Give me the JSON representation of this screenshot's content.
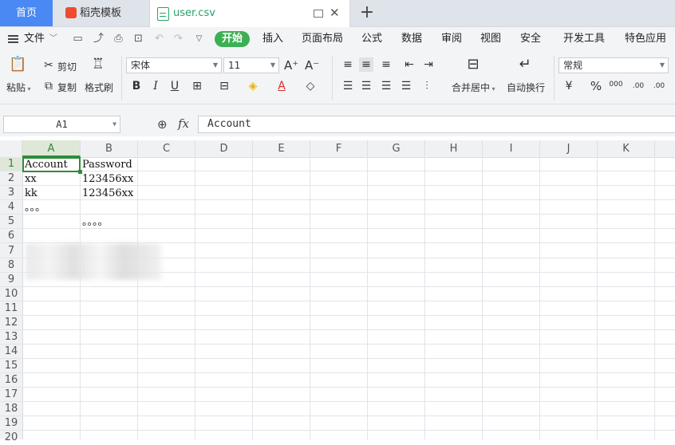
{
  "tabs": {
    "home": "首页",
    "template": "稻壳模板",
    "file": "user.csv"
  },
  "menu": {
    "file": "文件",
    "items": [
      "开始",
      "插入",
      "页面布局",
      "公式",
      "数据",
      "审阅",
      "视图",
      "安全",
      "开发工具",
      "特色应用"
    ]
  },
  "ribbon": {
    "paste": "粘贴",
    "cut": "剪切",
    "copy": "复制",
    "format_painter": "格式刷",
    "font_name": "宋体",
    "font_size": "11",
    "bold": "B",
    "italic": "I",
    "underline": "U",
    "font_color_letter": "A",
    "merge_center": "合并居中",
    "wrap_text": "自动换行",
    "number_format": "常规",
    "percent": "%",
    "thousands": "000",
    "inc_decimal": ".00",
    "dec_decimal": ".00"
  },
  "formula_bar": {
    "cell_ref": "A1",
    "fx": "fx",
    "value": "Account"
  },
  "columns": [
    "A",
    "B",
    "C",
    "D",
    "E",
    "F",
    "G",
    "H",
    "I",
    "J",
    "K"
  ],
  "rows": [
    "1",
    "2",
    "3",
    "4",
    "5",
    "6",
    "7",
    "8",
    "9",
    "10",
    "11",
    "12",
    "13",
    "14",
    "15",
    "16",
    "17",
    "18",
    "19",
    "20"
  ],
  "cells": {
    "a1": "Account",
    "b1": "Password",
    "a2": "xx",
    "b2": "123456xx",
    "a3": "kk",
    "b3": "123456xx",
    "a4": "。。。",
    "b5": "。。。。"
  },
  "colors": {
    "accent_green": "#3cb054",
    "home_tab_blue": "#4a89f3",
    "selection_green": "#2f8b3b"
  }
}
